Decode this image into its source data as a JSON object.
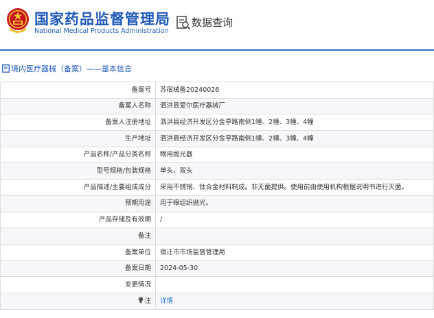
{
  "header": {
    "title_cn": "国家药品监督管理局",
    "title_en": "National Medical Products Administration",
    "query_title": "数据查询",
    "emblem_icon": "national-emblem-icon",
    "query_icon": "document-search-icon",
    "brand_color": "#1f59b6"
  },
  "section": {
    "title": "境内医疗器械（备案）——基本信息",
    "icon": "document-icon"
  },
  "rows": [
    {
      "label": "备案号",
      "value": "苏宿械备20240026"
    },
    {
      "label": "备案人名称",
      "value": "泗洪县爱尔医疗器械厂"
    },
    {
      "label": "备案人注册地址",
      "value": "泗洪县经济开发区分金亭路南侧1幢、2幢、3幢、4幢"
    },
    {
      "label": "生产地址",
      "value": "泗洪县经济开发区分金亭路南侧1幢、2幢、3幢、4幢"
    },
    {
      "label": "产品名称/产品分类名称",
      "value": "眼用抛光器"
    },
    {
      "label": "型号规格/包装规格",
      "value": "单头、双头"
    },
    {
      "label": "产品描述/主要组成成分",
      "value": "采用不锈钢、钛合金材料制成。非无菌提供。使用前由使用机构根据说明书进行灭菌。"
    },
    {
      "label": "预期用途",
      "value": "用于眼组织抛光。"
    },
    {
      "label": "产品存储及有效期",
      "value": "/"
    },
    {
      "label": "备注",
      "value": ""
    },
    {
      "label": "备案单位",
      "value": "宿迁市市场监督管理局"
    },
    {
      "label": "备案日期",
      "value": "2024-05-30"
    },
    {
      "label": "变更情况",
      "value": ""
    }
  ],
  "note": {
    "label": "注",
    "link": "详情",
    "icon": "lightbulb-icon"
  }
}
